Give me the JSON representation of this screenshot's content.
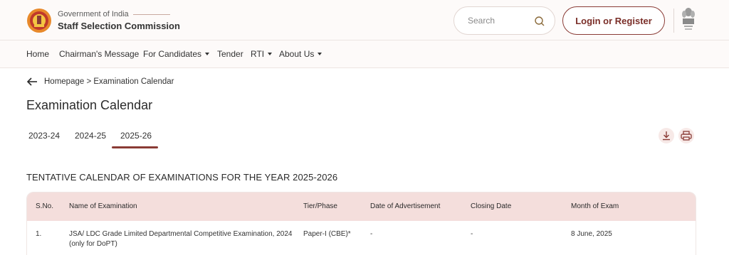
{
  "header": {
    "gov_text": "Government of India",
    "org_name": "Staff Selection Commission",
    "search_placeholder": "Search",
    "login_label": "Login or Register"
  },
  "nav": {
    "items": [
      {
        "label": "Home",
        "has_dropdown": false
      },
      {
        "label": "Chairman's Message",
        "has_dropdown": false
      },
      {
        "label": "For Candidates",
        "has_dropdown": true
      },
      {
        "label": "Tender",
        "has_dropdown": false
      },
      {
        "label": "RTI",
        "has_dropdown": true
      },
      {
        "label": "About Us",
        "has_dropdown": true
      }
    ]
  },
  "breadcrumb": {
    "text": "Homepage > Examination Calendar"
  },
  "page": {
    "title": "Examination Calendar"
  },
  "tabs": {
    "items": [
      "2023-24",
      "2024-25",
      "2025-26"
    ],
    "active": "2025-26"
  },
  "section": {
    "title": "TENTATIVE CALENDAR OF EXAMINATIONS FOR THE YEAR 2025-2026"
  },
  "table": {
    "headers": [
      "S.No.",
      "Name of Examination",
      "Tier/Phase",
      "Date of Advertisement",
      "Closing Date",
      "Month of Exam"
    ],
    "rows": [
      {
        "sno": "1.",
        "name_line1": "JSA/ LDC Grade Limited Departmental Competitive Examination, 2024",
        "name_line2": "(only for DoPT)",
        "tier": "Paper-I (CBE)*",
        "advertisement": "-",
        "closing": "-",
        "month": "8 June, 2025"
      }
    ]
  },
  "colors": {
    "brand": "#8a3b35",
    "header_bg": "#fdfaf9",
    "table_header_bg": "#f4dedc",
    "action_btn_bg": "#f7e9e7"
  },
  "icons": [
    "ssc-logo-icon",
    "search-icon",
    "emblem-icon",
    "back-arrow-icon",
    "download-icon",
    "print-icon"
  ]
}
